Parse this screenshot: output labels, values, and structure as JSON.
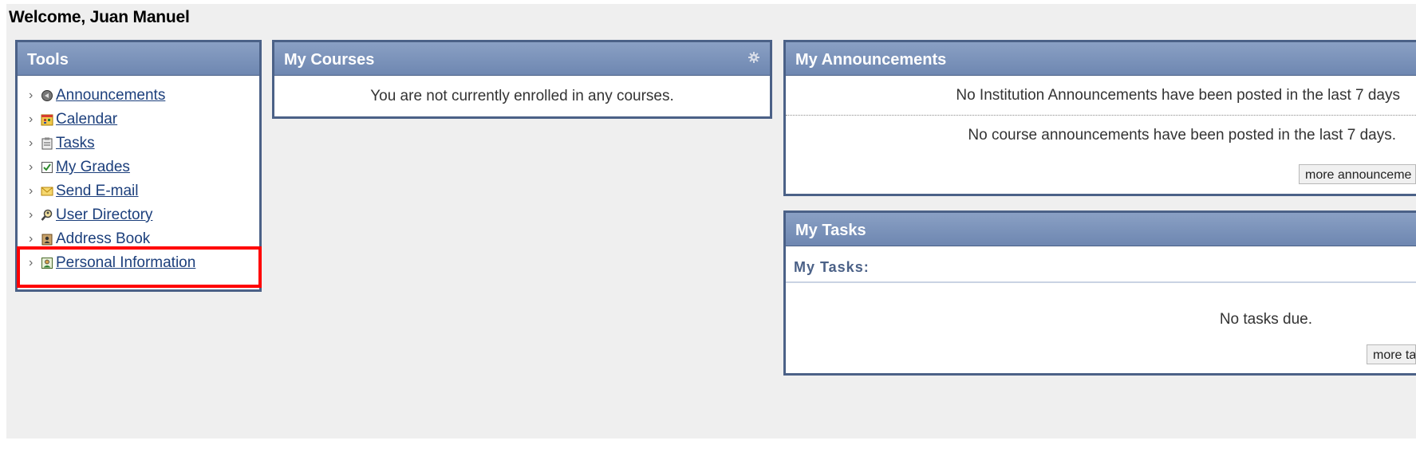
{
  "welcome": "Welcome, Juan Manuel",
  "tools": {
    "title": "Tools",
    "items": [
      {
        "label": "Announcements",
        "icon": "megaphone-icon",
        "link": true
      },
      {
        "label": "Calendar",
        "icon": "calendar-icon",
        "link": true
      },
      {
        "label": "Tasks",
        "icon": "clipboard-icon",
        "link": true
      },
      {
        "label": "My Grades",
        "icon": "grades-icon",
        "link": true
      },
      {
        "label": "Send E-mail",
        "icon": "envelope-icon",
        "link": true
      },
      {
        "label": "User Directory",
        "icon": "magnifier-person-icon",
        "link": true
      },
      {
        "label": "Address Book",
        "icon": "address-book-icon",
        "link": false
      },
      {
        "label": "Personal Information",
        "icon": "person-card-icon",
        "link": true
      }
    ]
  },
  "courses": {
    "title": "My Courses",
    "message": "You are not currently enrolled in any courses."
  },
  "announcements": {
    "title": "My Announcements",
    "institution_message": "No Institution Announcements have been posted in the last 7 days",
    "course_message": "No course announcements have been posted in the last 7 days.",
    "more_button": "more announceme"
  },
  "tasks": {
    "title": "My Tasks",
    "subheading": "My Tasks:",
    "message": "No tasks due.",
    "more_button": "more tas"
  },
  "colors": {
    "header_top": "#8aa0c4",
    "header_bottom": "#6e87b1",
    "border": "#4b6187",
    "link": "#1c3f7c",
    "highlight": "#ff0000"
  }
}
